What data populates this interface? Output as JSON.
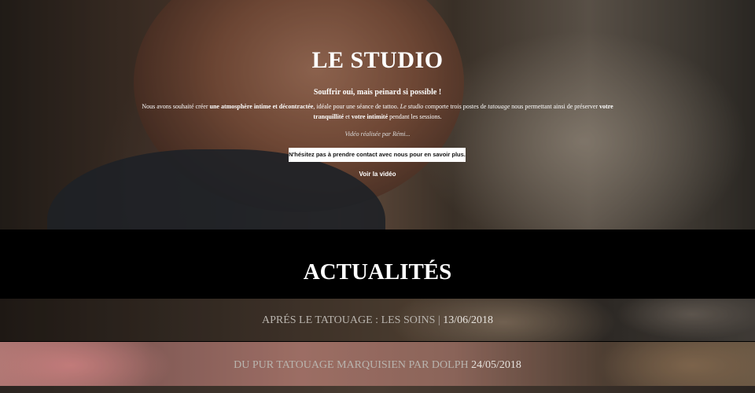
{
  "hero": {
    "title": "LE STUDIO",
    "subtitle": "Souffrir oui, mais peinard si possible !",
    "desc_1": "Nous avons souhaité créer ",
    "desc_2": "une atmosphère intime et décontractée",
    "desc_3": ", idéale pour une séance de tattoo. ",
    "desc_4": "Le studio",
    "desc_5": " comporte trois postes de ",
    "desc_6": "tatouage",
    "desc_7": " nous permettant ainsi de préserver ",
    "desc_8": "votre tranquillité",
    "desc_9": " et ",
    "desc_10": "votre intimité",
    "desc_11": " pendant les sessions.",
    "credit": "Vidéo réalisée par Rémi...",
    "cta_label": "N'hésitez pas à prendre contact avec nous pour en savoir plus.",
    "video_label": "Voir la vidéo"
  },
  "news": {
    "title": "ACTUALITÉS",
    "items": [
      {
        "title": "APRÉS LE TATOUAGE : LES SOINS",
        "separator": " | ",
        "date": "13/06/2018"
      },
      {
        "title": "DU PUR TATOUAGE MARQUISIEN PAR DOLPH",
        "separator": " ",
        "date": "24/05/2018"
      }
    ]
  }
}
